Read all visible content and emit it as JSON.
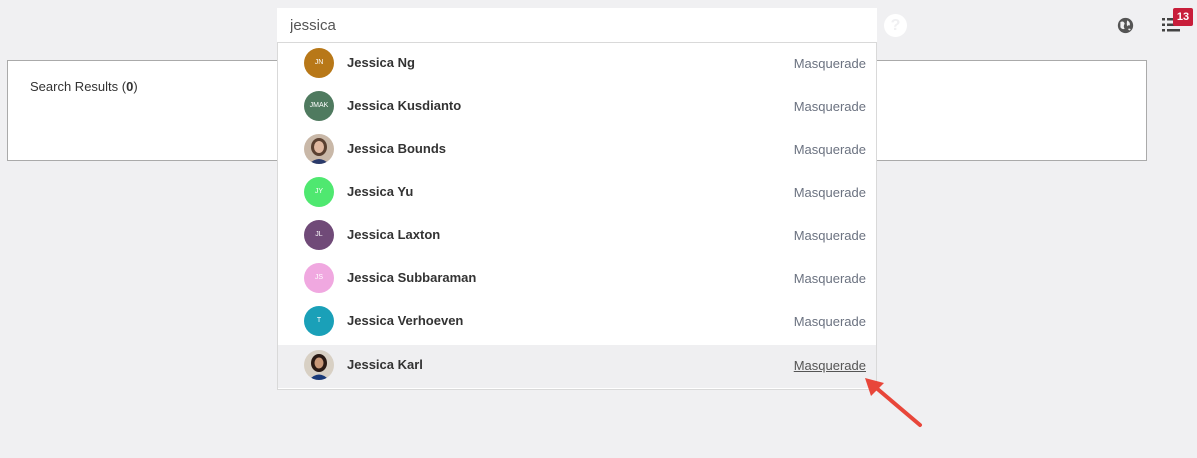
{
  "search": {
    "value": "jessica"
  },
  "header": {
    "help_glyph": "?",
    "notification_count": "13"
  },
  "results": {
    "label": "Search Results (",
    "count": "0",
    "close": ")"
  },
  "dropdown": {
    "items": [
      {
        "initials": "JN",
        "name": "Jessica Ng",
        "action": "Masquerade",
        "color": "#b87818"
      },
      {
        "initials": "JMAK",
        "name": "Jessica Kusdianto",
        "action": "Masquerade",
        "color": "#4f7a5f"
      },
      {
        "initials": "",
        "name": "Jessica Bounds",
        "action": "Masquerade",
        "color": "#7a6a5a",
        "photo": true
      },
      {
        "initials": "JY",
        "name": "Jessica Yu",
        "action": "Masquerade",
        "color": "#4fe870"
      },
      {
        "initials": "JL",
        "name": "Jessica Laxton",
        "action": "Masquerade",
        "color": "#704a78"
      },
      {
        "initials": "JS",
        "name": "Jessica Subbaraman",
        "action": "Masquerade",
        "color": "#f0a8e0"
      },
      {
        "initials": "T",
        "name": "Jessica Verhoeven",
        "action": "Masquerade",
        "color": "#1aa0b8"
      },
      {
        "initials": "",
        "name": "Jessica Karl",
        "action": "Masquerade",
        "color": "#2a3550",
        "photo": true,
        "active": true
      }
    ]
  },
  "colors": {
    "badge": "#c81e3a",
    "arrow": "#e8463a"
  }
}
